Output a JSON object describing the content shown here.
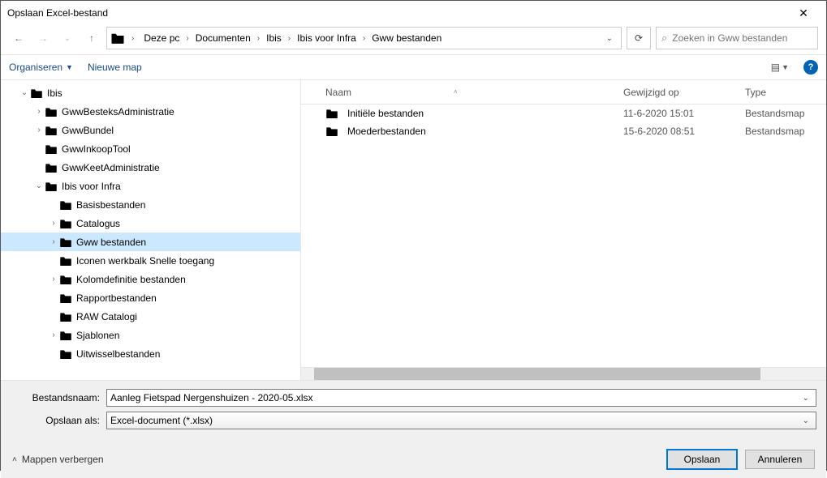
{
  "window": {
    "title": "Opslaan Excel-bestand"
  },
  "nav": {
    "breadcrumb": [
      "Deze pc",
      "Documenten",
      "Ibis",
      "Ibis voor Infra",
      "Gww bestanden"
    ],
    "search_placeholder": "Zoeken in Gww bestanden"
  },
  "toolbar": {
    "organize": "Organiseren",
    "new_folder": "Nieuwe map"
  },
  "tree": [
    {
      "label": "Ibis",
      "indent": 1,
      "caret": "open"
    },
    {
      "label": "GwwBesteksAdministratie",
      "indent": 2,
      "caret": "closed"
    },
    {
      "label": "GwwBundel",
      "indent": 2,
      "caret": "closed"
    },
    {
      "label": "GwwInkoopTool",
      "indent": 2,
      "caret": "none"
    },
    {
      "label": "GwwKeetAdministratie",
      "indent": 2,
      "caret": "none"
    },
    {
      "label": "Ibis voor Infra",
      "indent": 2,
      "caret": "open"
    },
    {
      "label": "Basisbestanden",
      "indent": 3,
      "caret": "none"
    },
    {
      "label": "Catalogus",
      "indent": 3,
      "caret": "closed"
    },
    {
      "label": "Gww bestanden",
      "indent": 3,
      "caret": "closed",
      "selected": true
    },
    {
      "label": "Iconen werkbalk Snelle toegang",
      "indent": 3,
      "caret": "none"
    },
    {
      "label": "Kolomdefinitie bestanden",
      "indent": 3,
      "caret": "closed"
    },
    {
      "label": "Rapportbestanden",
      "indent": 3,
      "caret": "none"
    },
    {
      "label": "RAW Catalogi",
      "indent": 3,
      "caret": "none"
    },
    {
      "label": "Sjablonen",
      "indent": 3,
      "caret": "closed"
    },
    {
      "label": "Uitwisselbestanden",
      "indent": 3,
      "caret": "none"
    }
  ],
  "columns": {
    "name": "Naam",
    "modified": "Gewijzigd op",
    "type": "Type"
  },
  "items": [
    {
      "name": "Initiële bestanden",
      "modified": "11-6-2020 15:01",
      "type": "Bestandsmap"
    },
    {
      "name": "Moederbestanden",
      "modified": "15-6-2020 08:51",
      "type": "Bestandsmap"
    }
  ],
  "fields": {
    "filename_label": "Bestandsnaam:",
    "filename_value": "Aanleg Fietspad Nergenshuizen - 2020-05.xlsx",
    "type_label": "Opslaan als:",
    "type_value": "Excel-document (*.xlsx)"
  },
  "footer": {
    "hide_folders": "Mappen verbergen",
    "save": "Opslaan",
    "cancel": "Annuleren"
  }
}
